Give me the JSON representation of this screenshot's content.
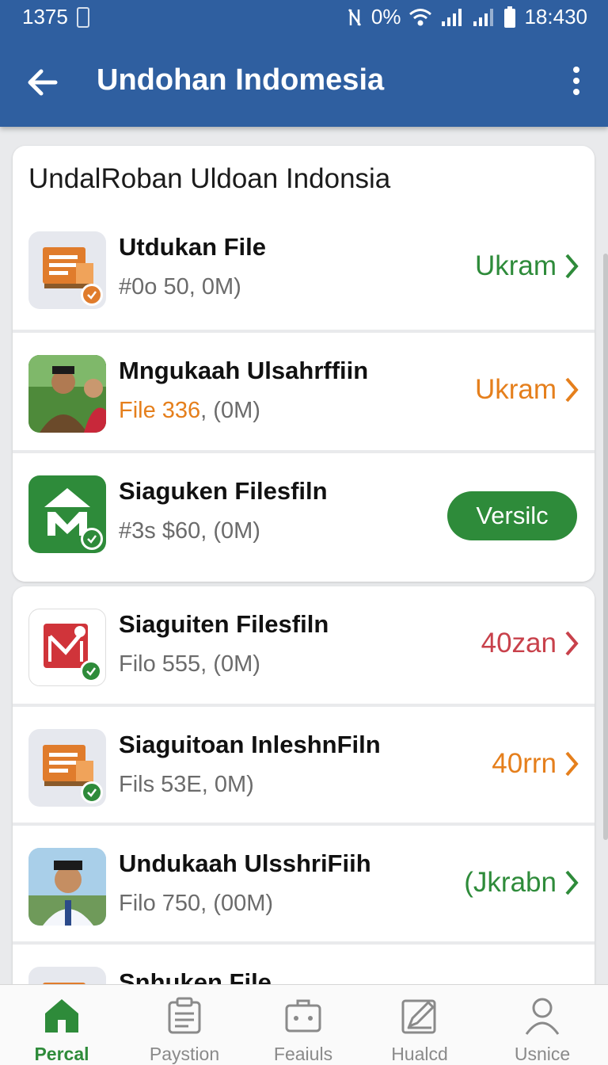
{
  "status_bar": {
    "left_text": "1375",
    "signal_text": "0%",
    "time": "18:430"
  },
  "app_bar": {
    "title": "Undohan Indomesia"
  },
  "section": {
    "title": "UndalRoban Uldoan Indonsia"
  },
  "rows": [
    {
      "name": "Utdukan File",
      "meta_highlight": "",
      "meta": "#0o 50, 0M)",
      "action": "Ukram",
      "action_color": "#2e8b3a",
      "icon": "building-document-icon"
    },
    {
      "name": "Mngukaah Ulsahrffiin",
      "meta_highlight": "File 336",
      "meta": ", (0M)",
      "action": "Ukram",
      "action_color": "#e57f1c",
      "icon": "people-photo-icon"
    },
    {
      "name": "Siaguken Filesfiln",
      "meta_highlight": "",
      "meta": "#3s $60, (0M)",
      "action": "Versilc",
      "action_color": "#2e8b3a",
      "icon": "green-m-house-icon"
    },
    {
      "name": "Siaguiten Filesfiln",
      "meta_highlight": "",
      "meta": "Filo 555, (0M)",
      "action": "40zan",
      "action_color": "#c8414b",
      "icon": "red-mail-icon"
    },
    {
      "name": "Siaguitoan InleshnFiln",
      "meta_highlight": "",
      "meta": "Fils 53E, 0M)",
      "action": "40rrn",
      "action_color": "#e57f1c",
      "icon": "building-document-icon"
    },
    {
      "name": "Undukaah UlsshriFiih",
      "meta_highlight": "",
      "meta": "Filo 750, (00M)",
      "action": "(Jkrabn",
      "action_color": "#2e8b3a",
      "icon": "person-photo-icon"
    },
    {
      "name": "Snhuken File",
      "meta_highlight": "",
      "meta": "",
      "action": "",
      "action_color": "#2e8b3a",
      "icon": "building-document-icon"
    }
  ],
  "bottom_nav": [
    {
      "label": "Percal",
      "icon": "home-icon",
      "active": true
    },
    {
      "label": "Paystion",
      "icon": "clipboard-icon",
      "active": false
    },
    {
      "label": "Feaiuls",
      "icon": "briefcase-icon",
      "active": false
    },
    {
      "label": "Hualcd",
      "icon": "edit-icon",
      "active": false
    },
    {
      "label": "Usnice",
      "icon": "user-icon",
      "active": false
    }
  ],
  "colors": {
    "primary": "#2f5fa0",
    "accent_green": "#2e8b3a",
    "accent_orange": "#e57f1c",
    "accent_red": "#c8414b"
  }
}
